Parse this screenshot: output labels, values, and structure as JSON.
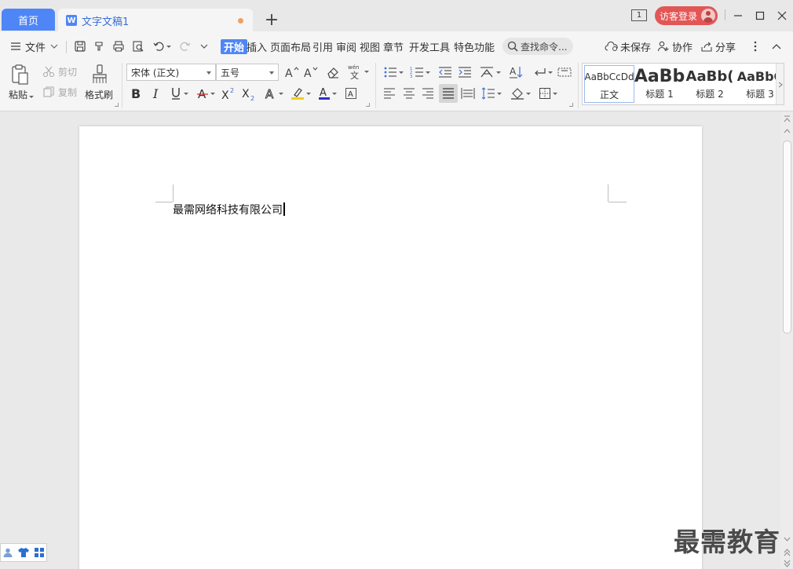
{
  "titlebar": {
    "home_tab": "首页",
    "doc_badge": "W",
    "doc_tab": "文字文稿1",
    "new_tab_symbol": "+",
    "window_count": "1",
    "login_button": "访客登录"
  },
  "menubar": {
    "file_menu": "文件",
    "tabs": [
      "开始",
      "插入",
      "页面布局",
      "引用",
      "审阅",
      "视图",
      "章节",
      "开发工具",
      "特色功能"
    ],
    "search_placeholder": "查找命令...",
    "unsaved": "未保存",
    "collaborate": "协作",
    "share": "分享"
  },
  "ribbon": {
    "paste": "粘贴",
    "cut": "剪切",
    "copy": "复制",
    "format_painter": "格式刷",
    "font_name": "宋体 (正文)",
    "font_size": "五号",
    "styles": [
      {
        "sample": "AaBbCcDd",
        "name": "正文"
      },
      {
        "sample": "AaBb",
        "name": "标题 1"
      },
      {
        "sample": "AaBb(",
        "name": "标题 2"
      },
      {
        "sample": "AaBbC",
        "name": "标题 3"
      }
    ],
    "accent_color": "#4f86f7",
    "highlight_color": "#f5d000",
    "font_color": "#2f2fd0"
  },
  "document": {
    "text": "最需网络科技有限公司"
  },
  "watermark": "最需教育"
}
